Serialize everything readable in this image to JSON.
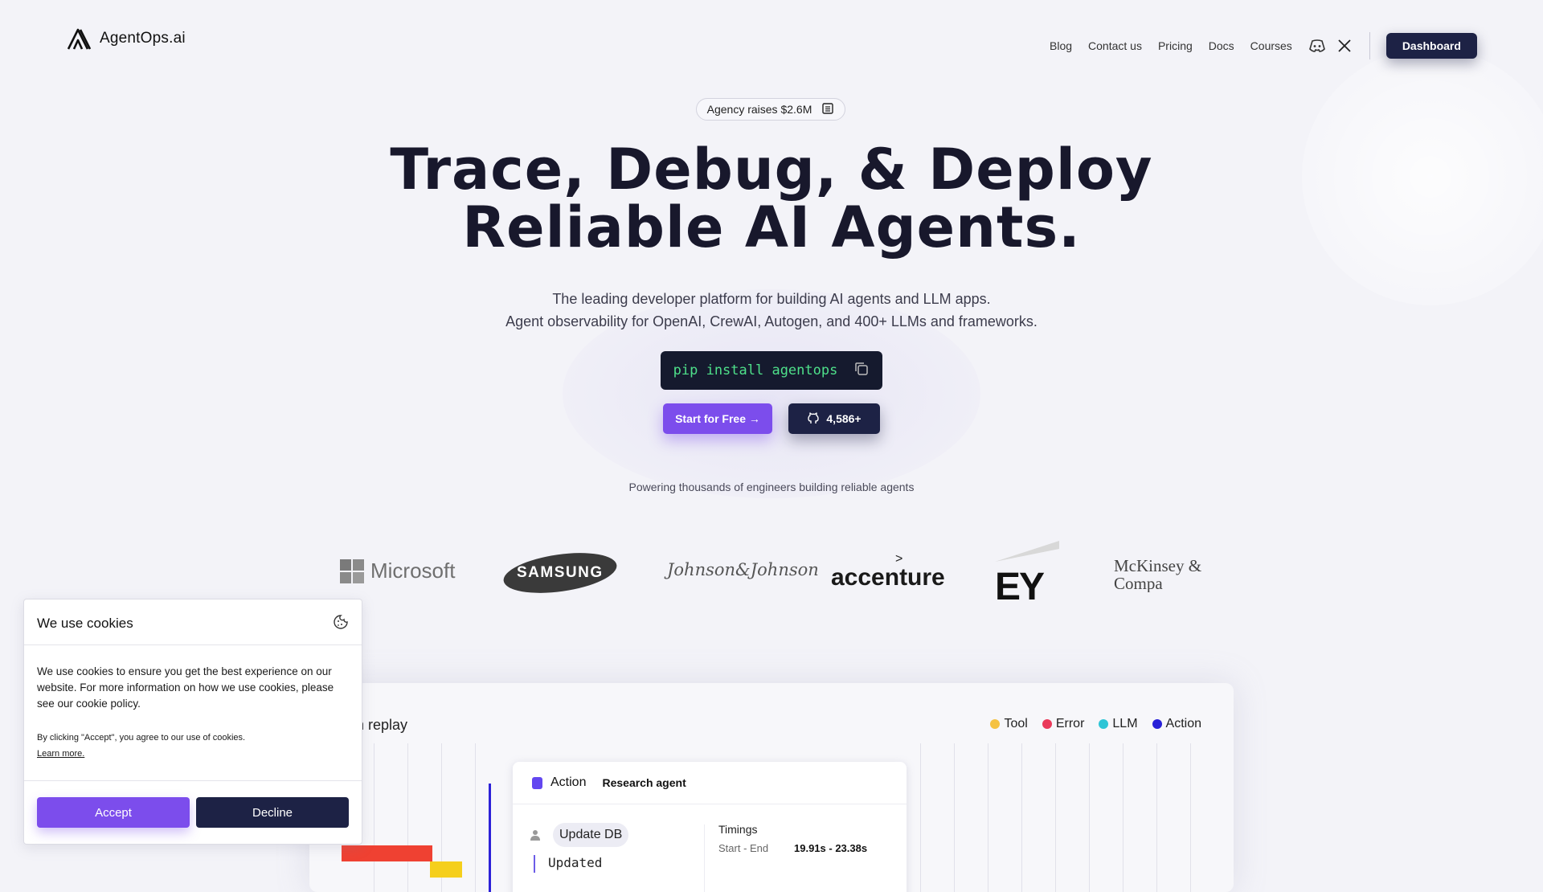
{
  "brand": {
    "name": "AgentOps.ai"
  },
  "nav": {
    "links": [
      "Blog",
      "Contact us",
      "Pricing",
      "Docs",
      "Courses"
    ],
    "dashboard": "Dashboard"
  },
  "hero": {
    "news_pill": "Agency raises $2.6M",
    "headline_line1": "Trace, Debug, & Deploy",
    "headline_line2": "Reliable AI Agents.",
    "sub_line1": "The leading developer platform for building AI agents and LLM apps.",
    "sub_line2": "Agent observability for OpenAI, CrewAI, Autogen, and 400+ LLMs and frameworks.",
    "pip_command": "pip install agentops",
    "start_button": "Start for Free →",
    "github_stars": "4,586+",
    "powering": "Powering thousands of engineers building reliable agents"
  },
  "customers": [
    "Microsoft",
    "SAMSUNG",
    "Johnson&Johnson",
    "accenture",
    "EY",
    "McKinsey & Compa"
  ],
  "session_replay": {
    "title": "ssion replay",
    "legend": [
      {
        "label": "Tool",
        "color": "#f5c242"
      },
      {
        "label": "Error",
        "color": "#ea3a5a"
      },
      {
        "label": "LLM",
        "color": "#2ec5d6"
      },
      {
        "label": "Action",
        "color": "#2820d8"
      }
    ],
    "card": {
      "type": "Action",
      "agent": "Research agent",
      "chip": "Update DB",
      "code": "Updated",
      "timings_label": "Timings",
      "start_end_label": "Start - End",
      "start_end_value": "19.91s - 23.38s"
    }
  },
  "cookie": {
    "title": "We use cookies",
    "body": "We use cookies to ensure you get the best experience on our website. For more information on how we use cookies, please see our cookie policy.",
    "consent": "By clicking \"Accept\", you agree to our use of cookies.",
    "learn_more": "Learn more.",
    "accept": "Accept",
    "decline": "Decline"
  },
  "colors": {
    "accent": "#7c4dec",
    "navy": "#1d2245",
    "background": "#f3f3f8",
    "terminal_green": "#4ee08a"
  }
}
